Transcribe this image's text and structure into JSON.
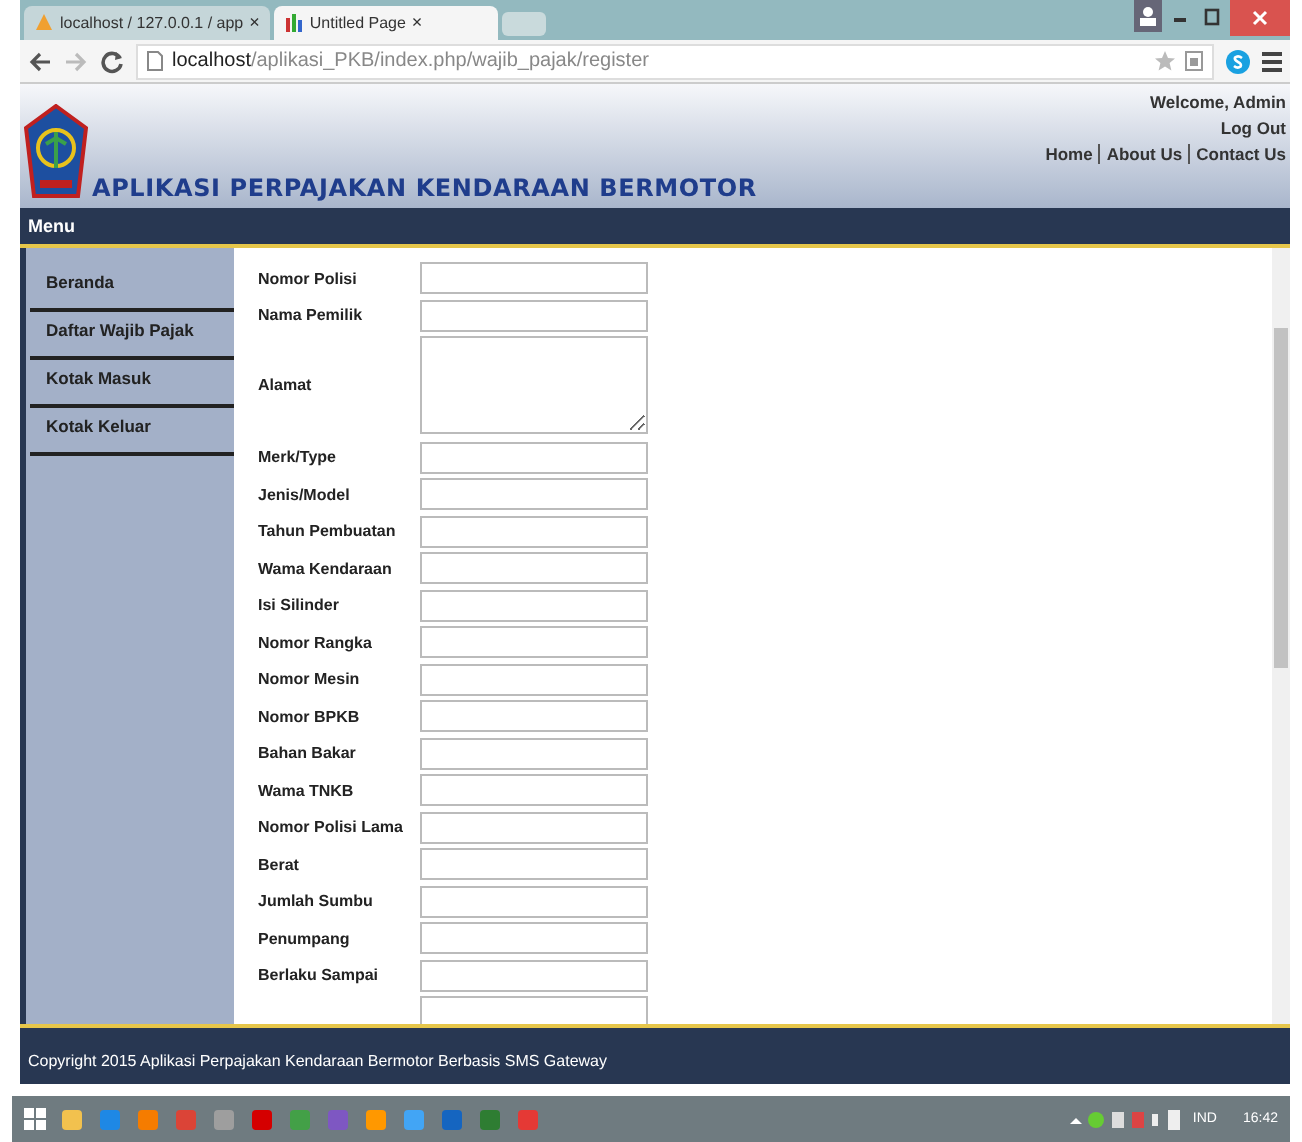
{
  "browser": {
    "tabs": [
      {
        "title": "localhost / 127.0.0.1 / app",
        "close": "×",
        "selected": false
      },
      {
        "title": "Untitled Page",
        "close": "×",
        "selected": true
      }
    ],
    "url_host": "localhost",
    "url_path": "/aplikasi_PKB/index.php/wajib_pajak/register"
  },
  "header": {
    "title": "APLIKASI PERPAJAKAN KENDARAAN BERMOTOR",
    "welcome": "Welcome, Admin",
    "logout": "Log Out",
    "links": [
      "Home",
      "About Us",
      "Contact Us"
    ]
  },
  "menu_bar": {
    "title": "Menu"
  },
  "sidebar": {
    "items": [
      {
        "label": "Beranda"
      },
      {
        "label": "Daftar Wajib Pajak"
      },
      {
        "label": "Kotak Masuk"
      },
      {
        "label": "Kotak Keluar"
      }
    ]
  },
  "form": {
    "fields": [
      {
        "label": "Nomor Polisi",
        "kind": "input"
      },
      {
        "label": "Nama Pemilik",
        "kind": "input"
      },
      {
        "label": "Alamat",
        "kind": "textarea"
      },
      {
        "label": "Merk/Type",
        "kind": "input"
      },
      {
        "label": "Jenis/Model",
        "kind": "input"
      },
      {
        "label": "Tahun Pembuatan",
        "kind": "input"
      },
      {
        "label": "Wama Kendaraan",
        "kind": "input"
      },
      {
        "label": "Isi Silinder",
        "kind": "input"
      },
      {
        "label": "Nomor Rangka",
        "kind": "input"
      },
      {
        "label": "Nomor Mesin",
        "kind": "input"
      },
      {
        "label": "Nomor BPKB",
        "kind": "input"
      },
      {
        "label": "Bahan Bakar",
        "kind": "input"
      },
      {
        "label": "Wama TNKB",
        "kind": "input"
      },
      {
        "label": "Nomor Polisi Lama",
        "kind": "input"
      },
      {
        "label": "Berat",
        "kind": "input"
      },
      {
        "label": "Jumlah Sumbu",
        "kind": "input"
      },
      {
        "label": "Penumpang",
        "kind": "input"
      },
      {
        "label": "Berlaku Sampai",
        "kind": "input"
      },
      {
        "kind": "input"
      }
    ]
  },
  "footer": {
    "text": "Copyright 2015 Aplikasi Perpajakan Kendaraan Bermotor Berbasis SMS Gateway"
  },
  "taskbar": {
    "language": "IND",
    "time": "16:42"
  }
}
